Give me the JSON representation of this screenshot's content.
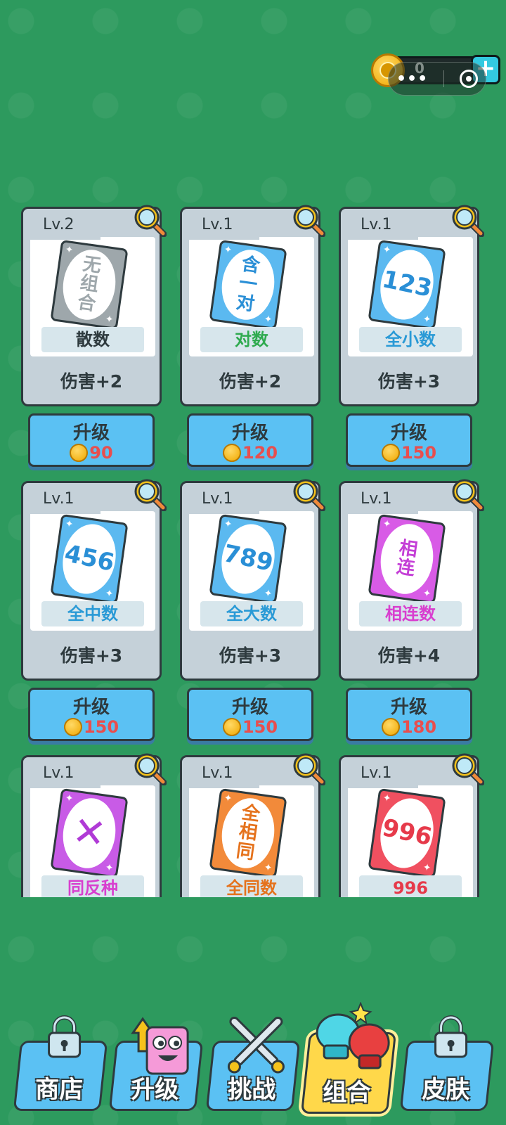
{
  "currency": {
    "amount": "0",
    "plus_icon": "plus-icon"
  },
  "capsule": {
    "menu": "•••"
  },
  "cards": [
    {
      "level": "Lv.2",
      "symbol": "无\n组\n合",
      "name": "散数",
      "damage": "伤害+2",
      "upgrade_label": "升级",
      "cost": "90",
      "card_color": "#9ea7ab",
      "symbol_color": "#9ea7ab",
      "name_color": "#2e3a3e"
    },
    {
      "level": "Lv.1",
      "symbol": "含\n一\n对",
      "name": "对数",
      "damage": "伤害+2",
      "upgrade_label": "升级",
      "cost": "120",
      "card_color": "#5bb9f0",
      "symbol_color": "#2a8fd6",
      "name_color": "#2eaa4e"
    },
    {
      "level": "Lv.1",
      "symbol": "123",
      "name": "全小数",
      "damage": "伤害+3",
      "upgrade_label": "升级",
      "cost": "150",
      "card_color": "#5bb9f0",
      "symbol_color": "#2a8fd6",
      "name_color": "#2a9ad6"
    },
    {
      "level": "Lv.1",
      "symbol": "456",
      "name": "全中数",
      "damage": "伤害+3",
      "upgrade_label": "升级",
      "cost": "150",
      "card_color": "#5bb9f0",
      "symbol_color": "#2a8fd6",
      "name_color": "#2a9ad6"
    },
    {
      "level": "Lv.1",
      "symbol": "789",
      "name": "全大数",
      "damage": "伤害+3",
      "upgrade_label": "升级",
      "cost": "150",
      "card_color": "#5bb9f0",
      "symbol_color": "#2a8fd6",
      "name_color": "#2a9ad6"
    },
    {
      "level": "Lv.1",
      "symbol": "相\n连",
      "name": "相连数",
      "damage": "伤害+4",
      "upgrade_label": "升级",
      "cost": "180",
      "card_color": "#d85be6",
      "symbol_color": "#c43fd6",
      "name_color": "#d83fcf"
    },
    {
      "level": "Lv.1",
      "symbol": "✕",
      "name": "同反种",
      "damage": "",
      "upgrade_label": "",
      "cost": "",
      "card_color": "#c85be6",
      "symbol_color": "#b03ad6",
      "name_color": "#d83fcf"
    },
    {
      "level": "Lv.1",
      "symbol": "全\n相\n同",
      "name": "全同数",
      "damage": "",
      "upgrade_label": "",
      "cost": "",
      "card_color": "#f28a3a",
      "symbol_color": "#e5721c",
      "name_color": "#e5721c"
    },
    {
      "level": "Lv.1",
      "symbol": "996",
      "name": "996",
      "damage": "",
      "upgrade_label": "",
      "cost": "",
      "card_color": "#f05060",
      "symbol_color": "#e63a4a",
      "name_color": "#e63a4a"
    }
  ],
  "nav": [
    {
      "label": "商店",
      "icon": "lock-icon"
    },
    {
      "label": "升级",
      "icon": "pink-face-icon"
    },
    {
      "label": "挑战",
      "icon": "crossed-swords-icon"
    },
    {
      "label": "组合",
      "icon": "boxing-gloves-icon",
      "active": true
    },
    {
      "label": "皮肤",
      "icon": "lock-icon"
    }
  ]
}
